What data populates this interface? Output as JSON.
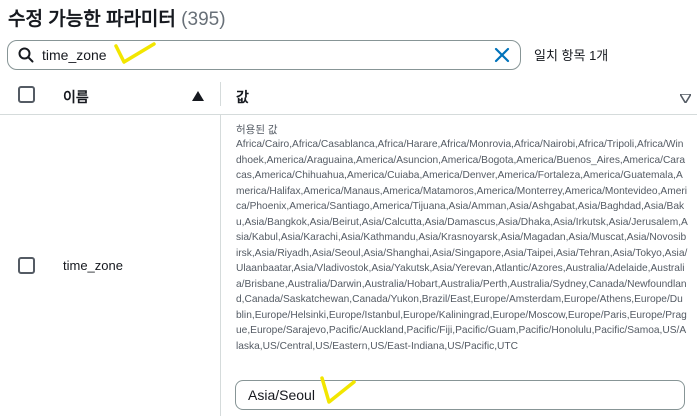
{
  "header": {
    "title": "수정 가능한 파라미터",
    "count": "(395)"
  },
  "search": {
    "value": "time_zone",
    "match_text": "일치 항목 1개"
  },
  "table": {
    "columns": {
      "name": "이름",
      "value": "값"
    },
    "rows": [
      {
        "name": "time_zone",
        "allowed_label": "허용된 값",
        "allowed_values": "Africa/Cairo,Africa/Casablanca,Africa/Harare,Africa/Monrovia,Africa/Nairobi,Africa/Tripoli,Africa/Windhoek,America/Araguaina,America/Asuncion,America/Bogota,America/Buenos_Aires,America/Caracas,America/Chihuahua,America/Cuiaba,America/Denver,America/Fortaleza,America/Guatemala,America/Halifax,America/Manaus,America/Matamoros,America/Monterrey,America/Montevideo,America/Phoenix,America/Santiago,America/Tijuana,Asia/Amman,Asia/Ashgabat,Asia/Baghdad,Asia/Baku,Asia/Bangkok,Asia/Beirut,Asia/Calcutta,Asia/Damascus,Asia/Dhaka,Asia/Irkutsk,Asia/Jerusalem,Asia/Kabul,Asia/Karachi,Asia/Kathmandu,Asia/Krasnoyarsk,Asia/Magadan,Asia/Muscat,Asia/Novosibirsk,Asia/Riyadh,Asia/Seoul,Asia/Shanghai,Asia/Singapore,Asia/Taipei,Asia/Tehran,Asia/Tokyo,Asia/Ulaanbaatar,Asia/Vladivostok,Asia/Yakutsk,Asia/Yerevan,Atlantic/Azores,Australia/Adelaide,Australia/Brisbane,Australia/Darwin,Australia/Hobart,Australia/Perth,Australia/Sydney,Canada/Newfoundland,Canada/Saskatchewan,Canada/Yukon,Brazil/East,Europe/Amsterdam,Europe/Athens,Europe/Dublin,Europe/Helsinki,Europe/Istanbul,Europe/Kaliningrad,Europe/Moscow,Europe/Paris,Europe/Prague,Europe/Sarajevo,Pacific/Auckland,Pacific/Fiji,Pacific/Guam,Pacific/Honolulu,Pacific/Samoa,US/Alaska,US/Central,US/Eastern,US/East-Indiana,US/Pacific,UTC",
        "value": "Asia/Seoul"
      }
    ]
  },
  "icons": {
    "search": "search-icon",
    "clear": "close-icon",
    "sort_asc": "caret-up-icon",
    "sort_desc": "caret-down-icon",
    "annotation": "checkmark-annotation"
  },
  "colors": {
    "accent": "#0073bb",
    "annotation": "#f2e600"
  }
}
